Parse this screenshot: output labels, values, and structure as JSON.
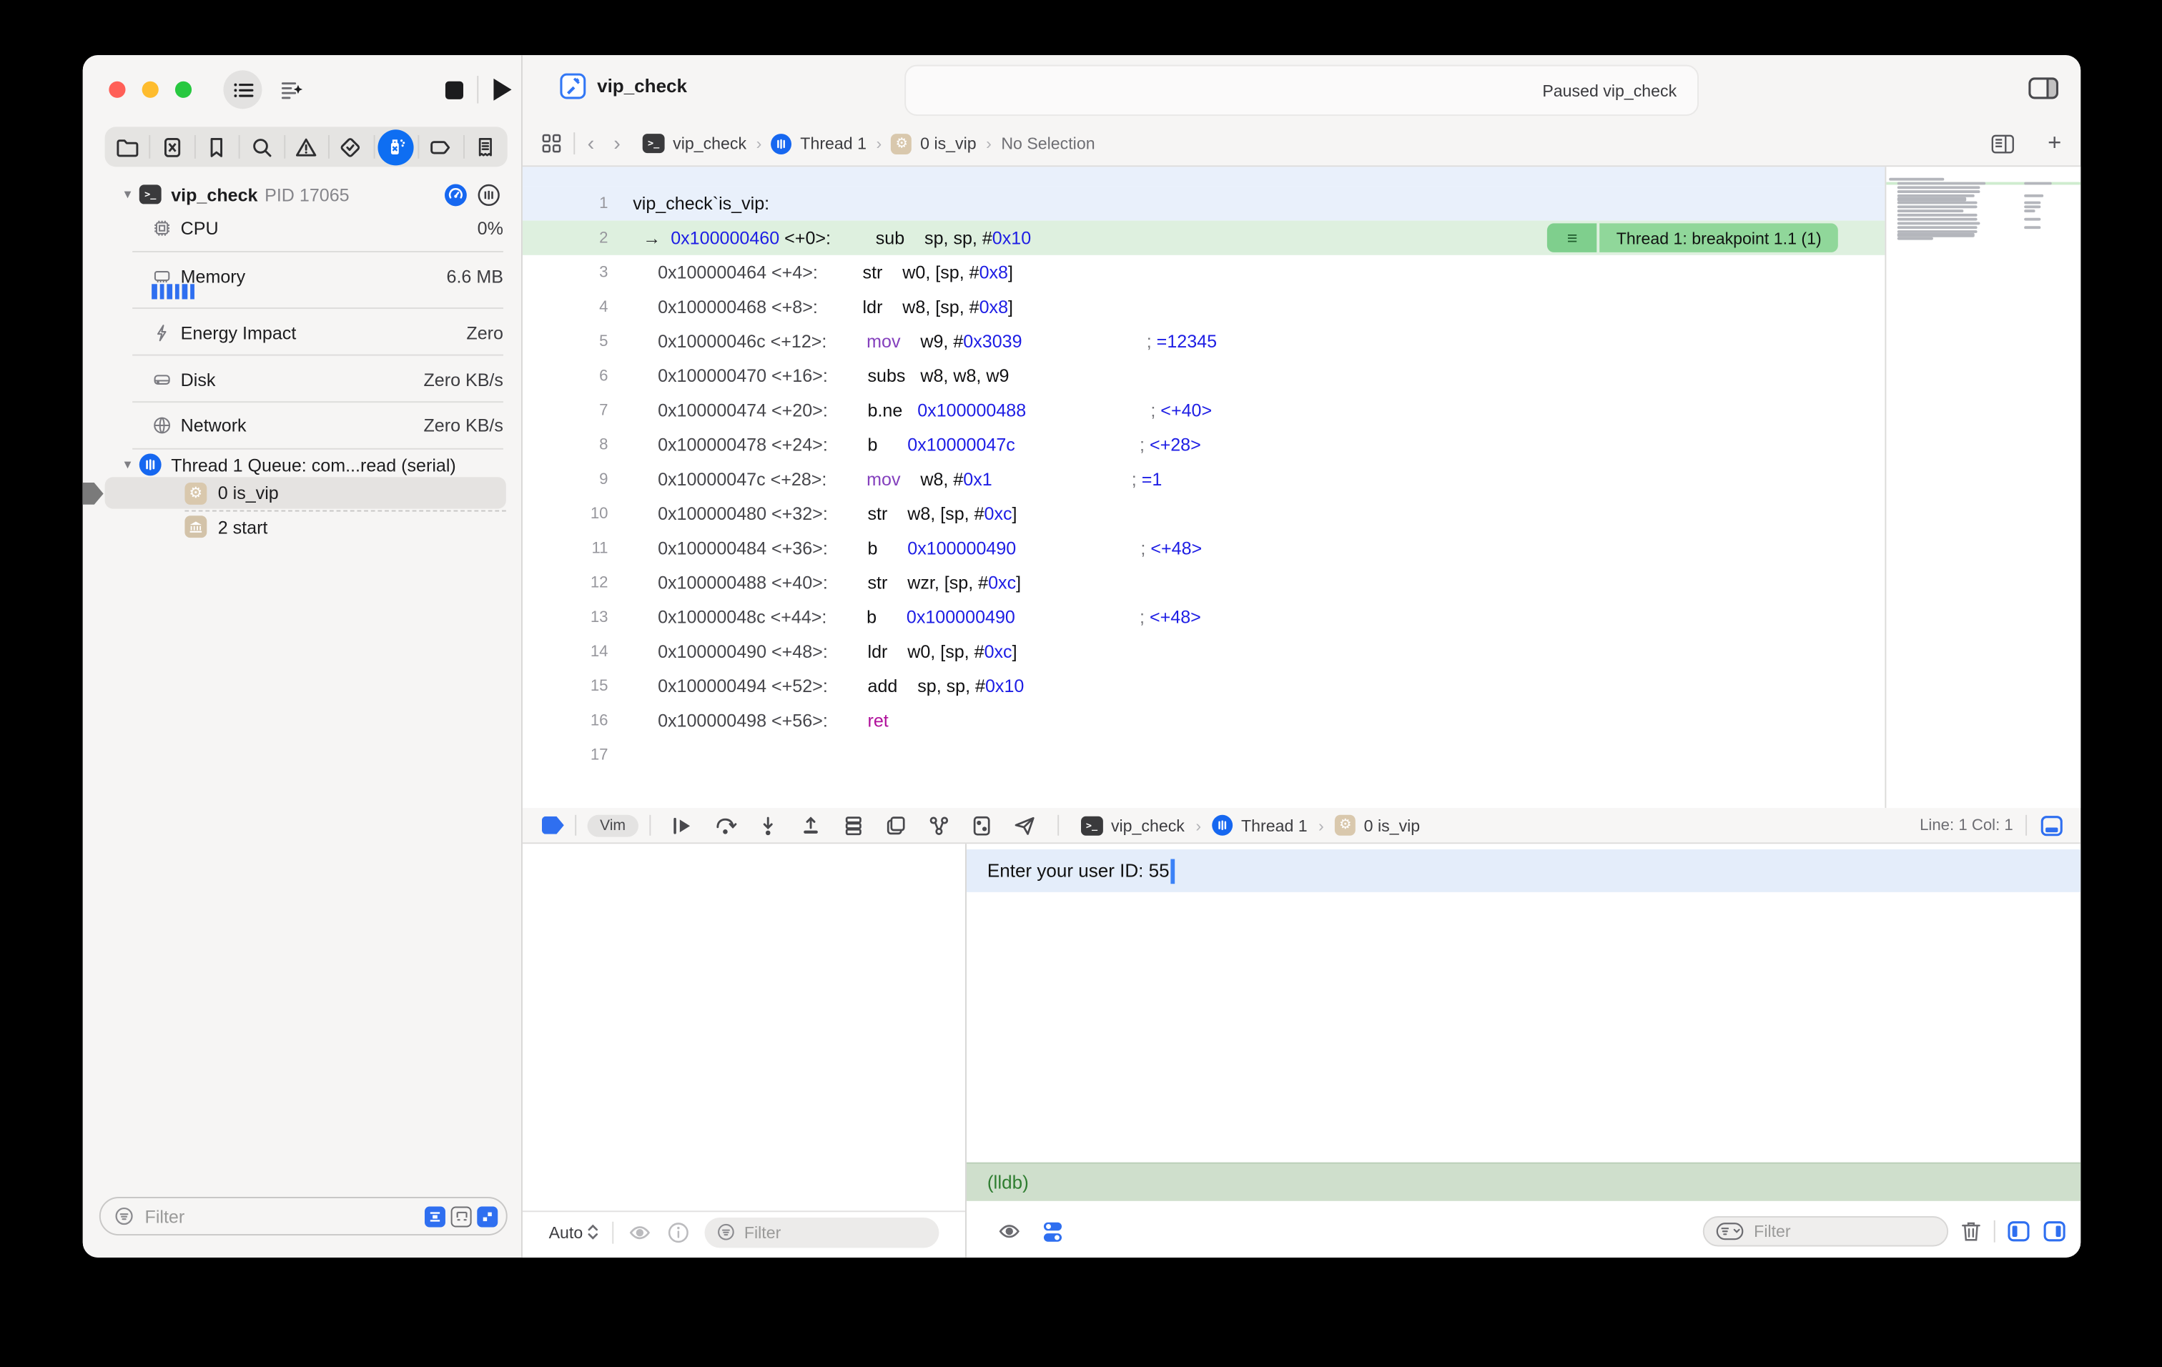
{
  "titlebar": {
    "status_text": "Paused vip_check"
  },
  "tab": {
    "label": "vip_check"
  },
  "navigator": {
    "process": {
      "name": "vip_check",
      "pid_label": "PID 17065"
    },
    "gauges": [
      {
        "label": "CPU",
        "value": "0%"
      },
      {
        "label": "Memory",
        "value": "6.6 MB"
      },
      {
        "label": "Energy Impact",
        "value": "Zero"
      },
      {
        "label": "Disk",
        "value": "Zero KB/s"
      },
      {
        "label": "Network",
        "value": "Zero KB/s"
      }
    ],
    "thread": {
      "label": "Thread 1 Queue: com...read (serial)"
    },
    "frames": [
      {
        "label": "0 is_vip"
      },
      {
        "label": "2 start"
      }
    ],
    "filter_placeholder": "Filter"
  },
  "jumpbar": {
    "items": [
      "vip_check",
      "Thread 1",
      "0 is_vip",
      "No Selection"
    ]
  },
  "editor": {
    "breakpoint_badge": "Thread 1: breakpoint 1.1 (1)",
    "code": {
      "lines": [
        {
          "n": "1",
          "hl": "blue",
          "segs": [
            [
              "vip_check`is_vip:",
              "blk"
            ]
          ]
        },
        {
          "n": "2",
          "hl": "green",
          "badge": true,
          "segs": [
            [
              "  ",
              "blk"
            ],
            [
              "→",
              "arr"
            ],
            [
              "  ",
              "blk"
            ],
            [
              "0x100000460",
              "blu"
            ],
            [
              " <+0>:         ",
              "blk"
            ],
            [
              "sub    ",
              "blk"
            ],
            [
              "sp, sp, #",
              "blk"
            ],
            [
              "0x10",
              "blu"
            ]
          ]
        },
        {
          "n": "3",
          "segs": [
            [
              "     ",
              "blk"
            ],
            [
              "0x100000464 <+4>:         ",
              "adr"
            ],
            [
              "str    ",
              "blk"
            ],
            [
              "w0, [sp, #",
              "blk"
            ],
            [
              "0x8",
              "blu"
            ],
            [
              "]",
              "blk"
            ]
          ]
        },
        {
          "n": "4",
          "segs": [
            [
              "     ",
              "blk"
            ],
            [
              "0x100000468 <+8>:         ",
              "adr"
            ],
            [
              "ldr    ",
              "blk"
            ],
            [
              "w8, [sp, #",
              "blk"
            ],
            [
              "0x8",
              "blu"
            ],
            [
              "]",
              "blk"
            ]
          ]
        },
        {
          "n": "5",
          "segs": [
            [
              "     ",
              "blk"
            ],
            [
              "0x10000046c <+12>:        ",
              "adr"
            ],
            [
              "mov    ",
              "pur"
            ],
            [
              "w9, #",
              "blk"
            ],
            [
              "0x3039",
              "blu"
            ],
            [
              "                         ",
              "blk"
            ],
            [
              "; ",
              "cmt"
            ],
            [
              "=12345",
              "blu"
            ]
          ]
        },
        {
          "n": "6",
          "segs": [
            [
              "     ",
              "blk"
            ],
            [
              "0x100000470 <+16>:        ",
              "adr"
            ],
            [
              "subs   ",
              "blk"
            ],
            [
              "w8, w8, w9",
              "blk"
            ]
          ]
        },
        {
          "n": "7",
          "segs": [
            [
              "     ",
              "blk"
            ],
            [
              "0x100000474 <+20>:        ",
              "adr"
            ],
            [
              "b.ne   ",
              "blk"
            ],
            [
              "0x100000488",
              "blu"
            ],
            [
              "                         ",
              "blk"
            ],
            [
              "; ",
              "cmt"
            ],
            [
              "<+40>",
              "blu"
            ]
          ]
        },
        {
          "n": "8",
          "segs": [
            [
              "     ",
              "blk"
            ],
            [
              "0x100000478 <+24>:        ",
              "adr"
            ],
            [
              "b      ",
              "blk"
            ],
            [
              "0x10000047c",
              "blu"
            ],
            [
              "                         ",
              "blk"
            ],
            [
              "; ",
              "cmt"
            ],
            [
              "<+28>",
              "blu"
            ]
          ]
        },
        {
          "n": "9",
          "segs": [
            [
              "     ",
              "blk"
            ],
            [
              "0x10000047c <+28>:        ",
              "adr"
            ],
            [
              "mov    ",
              "pur"
            ],
            [
              "w8, #",
              "blk"
            ],
            [
              "0x1",
              "blu"
            ],
            [
              "                            ",
              "blk"
            ],
            [
              "; ",
              "cmt"
            ],
            [
              "=1",
              "blu"
            ]
          ]
        },
        {
          "n": "10",
          "segs": [
            [
              "     ",
              "blk"
            ],
            [
              "0x100000480 <+32>:        ",
              "adr"
            ],
            [
              "str    ",
              "blk"
            ],
            [
              "w8, [sp, #",
              "blk"
            ],
            [
              "0xc",
              "blu"
            ],
            [
              "]",
              "blk"
            ]
          ]
        },
        {
          "n": "11",
          "segs": [
            [
              "     ",
              "blk"
            ],
            [
              "0x100000484 <+36>:        ",
              "adr"
            ],
            [
              "b      ",
              "blk"
            ],
            [
              "0x100000490",
              "blu"
            ],
            [
              "                         ",
              "blk"
            ],
            [
              "; ",
              "cmt"
            ],
            [
              "<+48>",
              "blu"
            ]
          ]
        },
        {
          "n": "12",
          "segs": [
            [
              "     ",
              "blk"
            ],
            [
              "0x100000488 <+40>:        ",
              "adr"
            ],
            [
              "str    ",
              "blk"
            ],
            [
              "wzr, [sp, #",
              "blk"
            ],
            [
              "0xc",
              "blu"
            ],
            [
              "]",
              "blk"
            ]
          ]
        },
        {
          "n": "13",
          "segs": [
            [
              "     ",
              "blk"
            ],
            [
              "0x10000048c <+44>:        ",
              "adr"
            ],
            [
              "b      ",
              "blk"
            ],
            [
              "0x100000490",
              "blu"
            ],
            [
              "                         ",
              "blk"
            ],
            [
              "; ",
              "cmt"
            ],
            [
              "<+48>",
              "blu"
            ]
          ]
        },
        {
          "n": "14",
          "segs": [
            [
              "     ",
              "blk"
            ],
            [
              "0x100000490 <+48>:        ",
              "adr"
            ],
            [
              "ldr    ",
              "blk"
            ],
            [
              "w0, [sp, #",
              "blk"
            ],
            [
              "0xc",
              "blu"
            ],
            [
              "]",
              "blk"
            ]
          ]
        },
        {
          "n": "15",
          "segs": [
            [
              "     ",
              "blk"
            ],
            [
              "0x100000494 <+52>:        ",
              "adr"
            ],
            [
              "add    ",
              "blk"
            ],
            [
              "sp, sp, #",
              "blk"
            ],
            [
              "0x10",
              "blu"
            ]
          ]
        },
        {
          "n": "16",
          "segs": [
            [
              "     ",
              "blk"
            ],
            [
              "0x100000498 <+56>:        ",
              "adr"
            ],
            [
              "ret",
              "mag"
            ]
          ]
        },
        {
          "n": "17",
          "segs": []
        }
      ]
    },
    "minimap_rows": [
      [
        [
          2,
          40
        ]
      ],
      [
        [
          8,
          64
        ],
        [
          100,
          20
        ]
      ],
      [
        [
          8,
          60
        ]
      ],
      [
        [
          8,
          60
        ]
      ],
      [
        [
          8,
          56
        ],
        [
          100,
          14
        ]
      ],
      [
        [
          8,
          50
        ]
      ],
      [
        [
          8,
          58
        ],
        [
          100,
          12
        ]
      ],
      [
        [
          8,
          58
        ],
        [
          100,
          12
        ]
      ],
      [
        [
          8,
          48
        ],
        [
          100,
          8
        ]
      ],
      [
        [
          8,
          58
        ]
      ],
      [
        [
          8,
          58
        ],
        [
          100,
          12
        ]
      ],
      [
        [
          8,
          60
        ]
      ],
      [
        [
          8,
          58
        ],
        [
          100,
          12
        ]
      ],
      [
        [
          8,
          58
        ]
      ],
      [
        [
          8,
          56
        ]
      ],
      [
        [
          8,
          26
        ]
      ]
    ]
  },
  "debugbar": {
    "vim_label": "Vim",
    "breadcrumb": [
      "vip_check",
      "Thread 1",
      "0 is_vip"
    ],
    "line_col": "Line: 1 Col: 1"
  },
  "variables_pane": {
    "scope_label": "Auto",
    "filter_placeholder": "Filter"
  },
  "console": {
    "prompt_text": "Enter your user ID: 55",
    "lldb_label": "(lldb)",
    "filter_placeholder": "Filter"
  },
  "colors": {
    "accent_blue": "#1667f0",
    "breakpoint_green": "#90d79a",
    "current_line_green": "#def0df",
    "selected_line_blue": "#e9f0fb",
    "code_address_blue": "#1d1de4",
    "keyword_purple": "#8440bd",
    "keyword_magenta": "#b0109b",
    "lldb_green": "#2e7d30"
  }
}
